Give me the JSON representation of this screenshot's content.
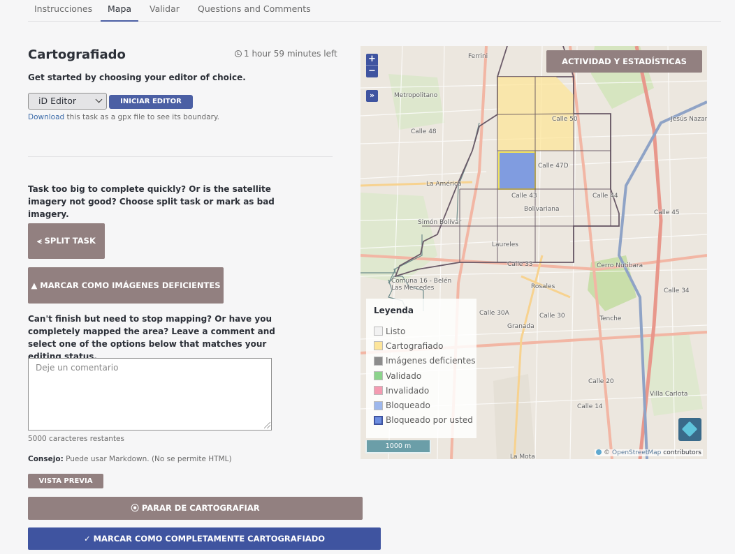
{
  "tabs": [
    {
      "label": "Instrucciones"
    },
    {
      "label": "Mapa"
    },
    {
      "label": "Validar"
    },
    {
      "label": "Questions and Comments"
    }
  ],
  "panel": {
    "title": "Cartografiado",
    "timer": "1 hour 59 minutes left",
    "editor_prompt": "Get started by choosing your editor of choice.",
    "editor_selected": "iD Editor",
    "start_editor_label": "INICIAR EDITOR",
    "download_link": "Download",
    "download_text": " this task as a gpx file to see its boundary.",
    "split_prompt": "Task too big to complete quickly? Or is the satellite imagery not good? Choose split task or mark as bad imagery.",
    "split_label": "SPLIT TASK",
    "bad_imagery_label": "MARCAR COMO IMÁGENES DEFICIENTES",
    "finish_prompt": "Can't finish but need to stop mapping? Or have you completely mapped the area? Leave a comment and select one of the options below that matches your editing status.",
    "comment_placeholder": "Deje un comentario",
    "chars_remaining": "5000 caracteres restantes",
    "tip_label": "Consejo:",
    "tip_text": " Puede usar Markdown. (No se permite HTML)",
    "preview_label": "VISTA PREVIA",
    "stop_label": "PARAR DE CARTOGRAFIAR",
    "complete_label": "MARCAR COMO COMPLETAMENTE CARTOGRAFIADO"
  },
  "map": {
    "zoom_in": "+",
    "zoom_out": "−",
    "expand": "»",
    "stats_label": "ACTIVIDAD Y ESTADÍSTICAS",
    "legend_title": "Leyenda",
    "legend": [
      {
        "label": "Listo",
        "color": "#f2f2f2"
      },
      {
        "label": "Cartografiado",
        "color": "#fde59a"
      },
      {
        "label": "Imágenes deficientes",
        "color": "#8c8c8c"
      },
      {
        "label": "Validado",
        "color": "#8bd38b"
      },
      {
        "label": "Invalidado",
        "color": "#f49bb1"
      },
      {
        "label": "Bloqueado",
        "color": "#9db7ec"
      },
      {
        "label": "Bloqueado por usted",
        "color": "#6d8ee0"
      }
    ],
    "scale": "1000 m",
    "attribution_prefix": "© ",
    "attribution_osm": "OpenStreetMap",
    "attribution_suffix": " contributors",
    "place_labels": [
      "Ferrini",
      "Metropolitano",
      "Calle 48",
      "La América",
      "Simón Bolívar",
      "Bolivariana",
      "Laureles",
      "Calle 33",
      "Comuna 16 - Belén",
      "Las Mercedes",
      "Rosales",
      "Calle 30A",
      "Calle 30",
      "Granada",
      "Tenche",
      "Calle 20",
      "Calle 14",
      "Villa Carlota",
      "La Mota",
      "Cerro Nutibara",
      "Calle 50",
      "Calle 47D",
      "Calle 43",
      "Calle 44",
      "Calle 45",
      "Calle 34",
      "Jesús Nazareno"
    ]
  }
}
